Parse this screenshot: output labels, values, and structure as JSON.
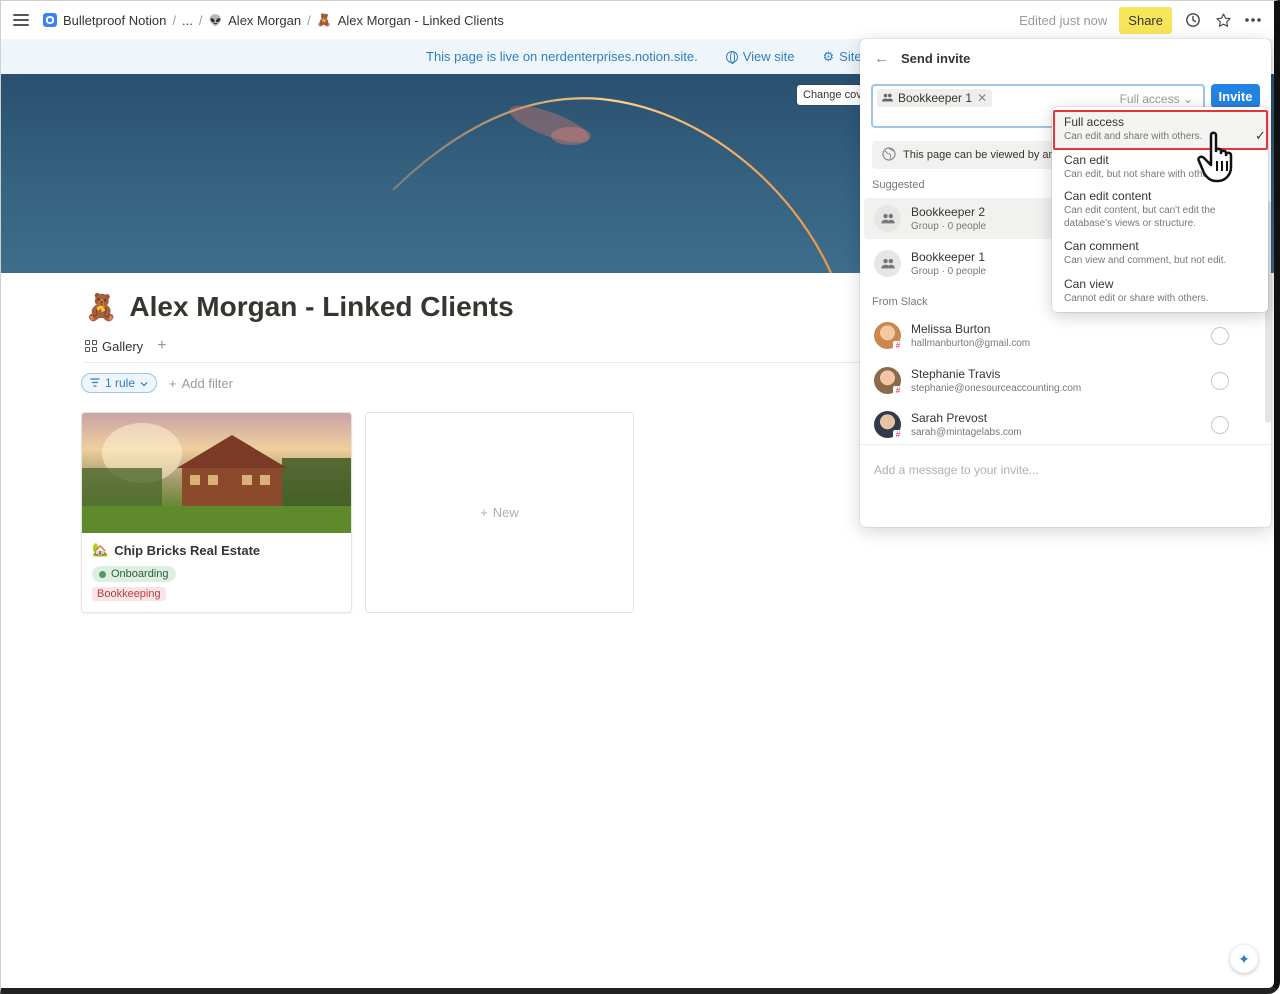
{
  "breadcrumb": {
    "workspace": "Bulletproof Notion",
    "sep1": "/",
    "ellipsis": "...",
    "sep2": "/",
    "parent": "Alex Morgan",
    "sep3": "/",
    "current": "Alex Morgan - Linked Clients"
  },
  "topbar": {
    "edited": "Edited just now",
    "share_label": "Share"
  },
  "banner": {
    "live_text": "This page is live on nerdenterprises.notion.site.",
    "view_site": "View site",
    "site_settings": "Site settings"
  },
  "cover": {
    "change_cover": "Change cove"
  },
  "page": {
    "icon": "🧸",
    "title": "Alex Morgan - Linked Clients",
    "view_tab": "Gallery",
    "add_view": "+",
    "rule_filter": "1 rule",
    "add_filter": "Add filter"
  },
  "gallery": {
    "card": {
      "title": "Chip Bricks Real Estate",
      "status": "Onboarding",
      "tag": "Bookkeeping"
    },
    "new_label": "New"
  },
  "share_panel": {
    "title": "Send invite",
    "chip_label": "Bookkeeper 1",
    "access_value": "Full access",
    "invite_button": "Invite",
    "view_notice": "This page can be viewed by anyon",
    "suggested_label": "Suggested",
    "suggested": [
      {
        "name": "Bookkeeper 2",
        "sub": "Group · 0 people"
      },
      {
        "name": "Bookkeeper 1",
        "sub": "Group · 0 people"
      }
    ],
    "slack_label": "From Slack",
    "slack": [
      {
        "name": "Melissa Burton",
        "email": "hallmanburton@gmail.com"
      },
      {
        "name": "Stephanie Travis",
        "email": "stephanie@onesourceaccounting.com"
      },
      {
        "name": "Sarah Prevost",
        "email": "sarah@mintagelabs.com"
      }
    ],
    "message_placeholder": "Add a message to your invite..."
  },
  "access_menu": [
    {
      "title": "Full access",
      "desc": "Can edit and share with others."
    },
    {
      "title": "Can edit",
      "desc": "Can edit, but not share with others."
    },
    {
      "title": "Can edit content",
      "desc1": "Can edit content, but can't edit the",
      "desc2": "database's views or structure."
    },
    {
      "title": "Can comment",
      "desc": "Can view and comment, but not edit."
    },
    {
      "title": "Can view",
      "desc": "Cannot edit or share with others."
    }
  ],
  "colors": {
    "share_button": "#f7e55a",
    "invite_button": "#2383e2",
    "highlight_border": "#e5353a",
    "banner_text": "#2f7fc1"
  }
}
